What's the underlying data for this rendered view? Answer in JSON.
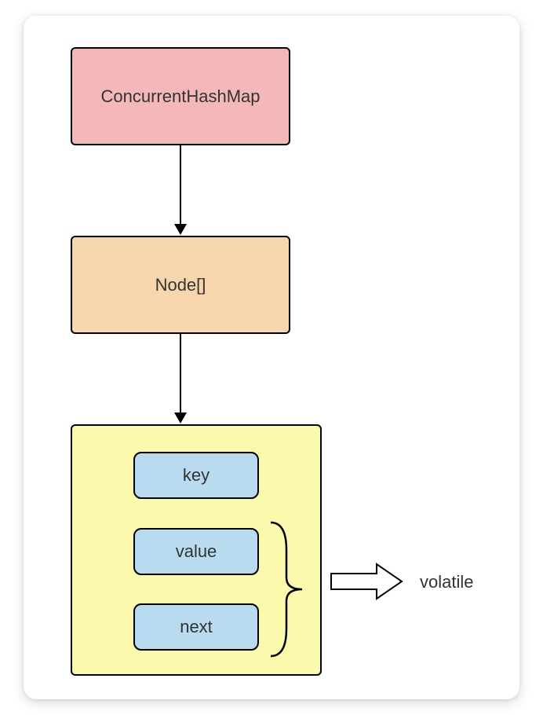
{
  "boxes": {
    "top": "ConcurrentHashMap",
    "middle": "Node[]",
    "fields": {
      "key": "key",
      "value": "value",
      "next": "next"
    }
  },
  "annotation": "volatile",
  "colors": {
    "pink": "#f4b8b8",
    "orange": "#f7d5ad",
    "yellow": "#fbfaac",
    "blue": "#b9dbf0"
  }
}
